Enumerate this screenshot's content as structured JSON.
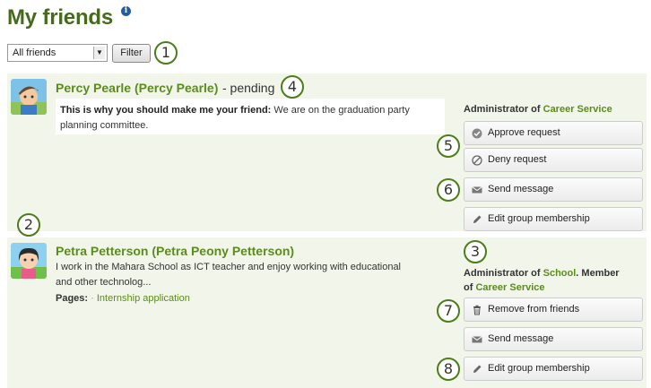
{
  "page": {
    "title": "My friends",
    "info_icon": "i"
  },
  "filter": {
    "selected": "All friends",
    "button_label": "Filter"
  },
  "callouts": [
    "1",
    "2",
    "3",
    "4",
    "5",
    "6",
    "7",
    "8"
  ],
  "friends": [
    {
      "name": "Percy Pearle (Percy Pearle)",
      "status": "- pending",
      "message_label": "This is why you should make me your friend:",
      "message": "We are on the graduation party planning committee.",
      "membership_prefix": "Administrator of",
      "membership_group": "Career Service",
      "actions": [
        {
          "label": "Approve request",
          "icon": "check-circle-icon"
        },
        {
          "label": "Deny request",
          "icon": "block-icon"
        },
        {
          "label": "Send message",
          "icon": "envelope-icon"
        },
        {
          "label": "Edit group membership",
          "icon": "pencil-icon"
        }
      ]
    },
    {
      "name": "Petra Petterson (Petra Peony Petterson)",
      "description_line1": "I work in the Mahara School as ICT teacher and enjoy working with educational",
      "description_line2": "and other technolog...",
      "pages_label": "Pages:",
      "pages_link": "Internship application",
      "membership_prefix": "Administrator of",
      "membership_group1": "School",
      "membership_mid": ". Member",
      "membership_of": "of",
      "membership_group2": "Career Service",
      "actions": [
        {
          "label": "Remove from friends",
          "icon": "trash-icon"
        },
        {
          "label": "Send message",
          "icon": "envelope-icon"
        },
        {
          "label": "Edit group membership",
          "icon": "pencil-icon"
        }
      ]
    }
  ]
}
